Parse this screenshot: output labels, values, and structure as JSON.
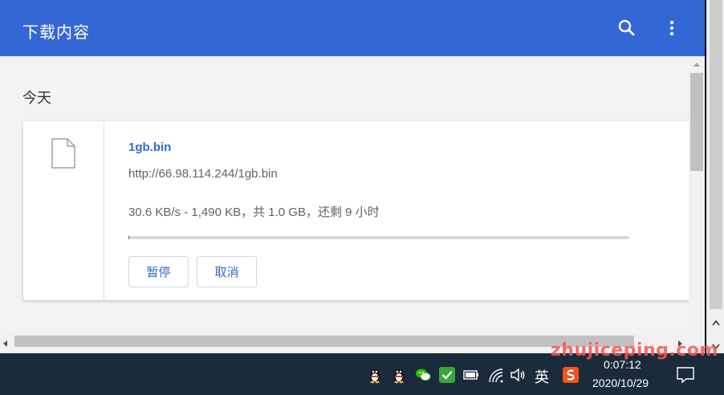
{
  "header": {
    "title": "下载内容",
    "search_icon": "search-icon",
    "more_icon": "more-vert-icon"
  },
  "section": {
    "label": "今天"
  },
  "download": {
    "file_name": "1gb.bin",
    "url": "http://66.98.114.244/1gb.bin",
    "status": "30.6 KB/s - 1,490 KB，共 1.0 GB，还剩 9 小时",
    "progress_fraction": 0.0015,
    "pause_label": "暂停",
    "cancel_label": "取消"
  },
  "taskbar": {
    "ime_label": "英",
    "time": "0:07:12",
    "date": "2020/10/29"
  },
  "watermark": "zhujiceping.com",
  "colors": {
    "header": "#3367d6",
    "accent": "#3367d6",
    "taskbar": "#1a2b3c",
    "watermark": "#ff5252"
  }
}
